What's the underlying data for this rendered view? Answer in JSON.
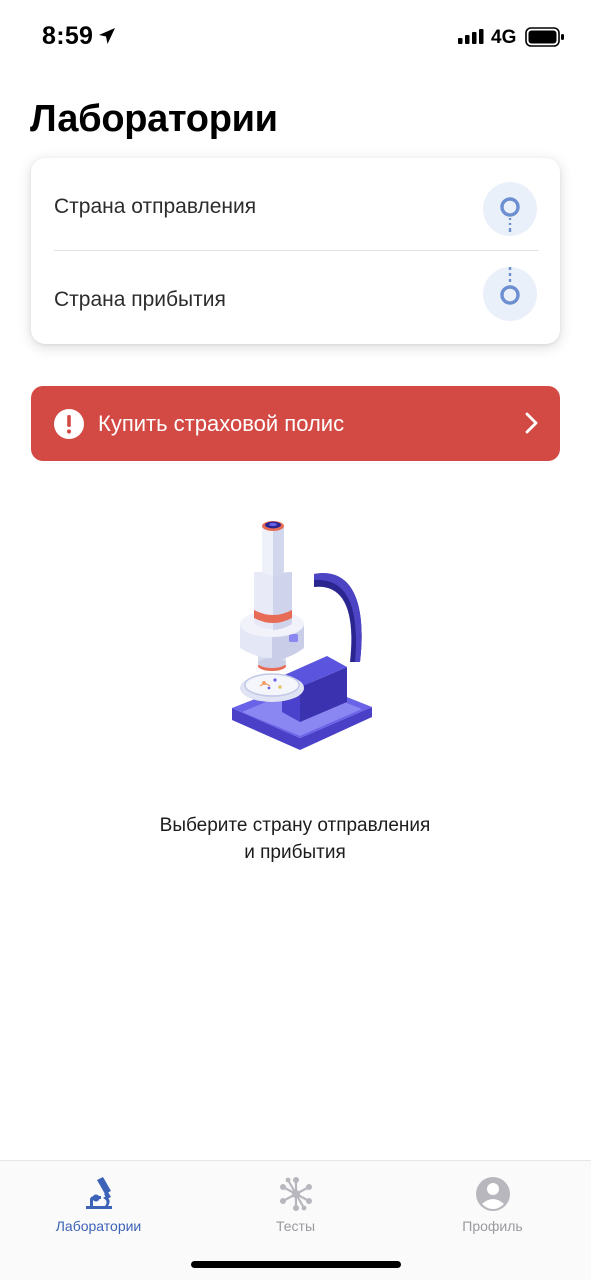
{
  "status_bar": {
    "time": "8:59",
    "network": "4G",
    "icons": [
      "location-arrow-icon",
      "signal-icon",
      "battery-icon"
    ]
  },
  "page": {
    "title": "Лаборатории"
  },
  "route_card": {
    "departure_label": "Страна отправления",
    "arrival_label": "Страна прибытия",
    "icons": [
      "departure-pin-icon",
      "arrival-pin-icon"
    ]
  },
  "insurance_banner": {
    "label": "Купить страховой полис",
    "color": "#d34a45",
    "icons": [
      "alert-icon",
      "chevron-right-icon"
    ]
  },
  "empty_state": {
    "illustration": "microscope-illustration",
    "message_line1": "Выберите страну отправления",
    "message_line2": "и прибытия"
  },
  "tab_bar": {
    "active_color": "#3d63b8",
    "inactive_color": "#9a9aa0",
    "tabs": [
      {
        "label": "Лаборатории",
        "icon": "microscope-icon",
        "active": true
      },
      {
        "label": "Тесты",
        "icon": "molecule-icon",
        "active": false
      },
      {
        "label": "Профиль",
        "icon": "profile-icon",
        "active": false
      }
    ]
  }
}
